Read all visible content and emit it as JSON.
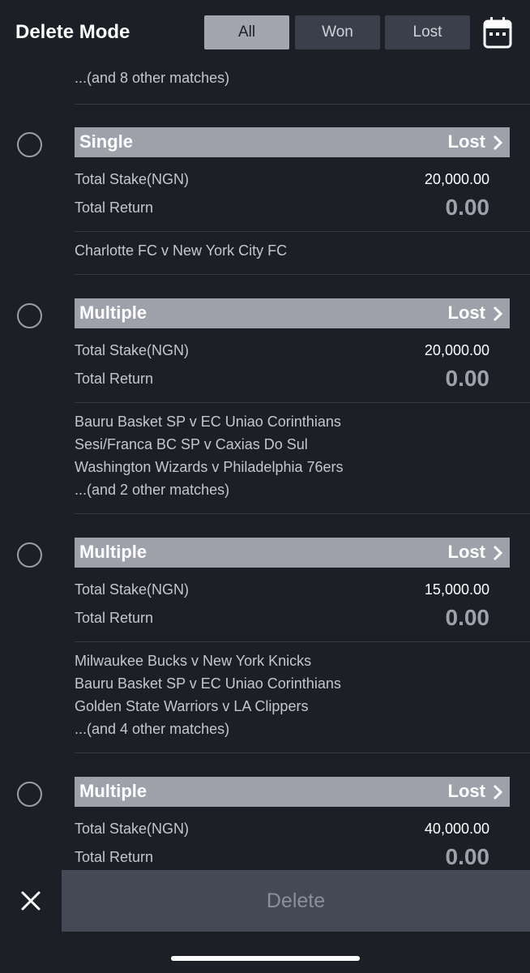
{
  "header": {
    "title": "Delete Mode",
    "filters": [
      "All",
      "Won",
      "Lost"
    ],
    "active_filter": "All",
    "calendar_icon": "calendar-icon"
  },
  "top_more": "...(and 8 other matches)",
  "bets": [
    {
      "type": "Single",
      "status": "Lost",
      "stake_label": "Total Stake(NGN)",
      "stake": "20,000.00",
      "return_label": "Total Return",
      "return": "0.00",
      "matches": [
        "Charlotte FC v New York City FC"
      ]
    },
    {
      "type": "Multiple",
      "status": "Lost",
      "stake_label": "Total Stake(NGN)",
      "stake": "20,000.00",
      "return_label": "Total Return",
      "return": "0.00",
      "matches": [
        "Bauru Basket SP v EC Uniao Corinthians",
        "Sesi/Franca BC SP v Caxias Do Sul",
        "Washington Wizards v Philadelphia 76ers",
        "...(and 2 other matches)"
      ]
    },
    {
      "type": "Multiple",
      "status": "Lost",
      "stake_label": "Total Stake(NGN)",
      "stake": "15,000.00",
      "return_label": "Total Return",
      "return": "0.00",
      "matches": [
        "Milwaukee Bucks v New York Knicks",
        "Bauru Basket SP v EC Uniao Corinthians",
        "Golden State Warriors v LA Clippers",
        "...(and 4 other matches)"
      ]
    },
    {
      "type": "Multiple",
      "status": "Lost",
      "stake_label": "Total Stake(NGN)",
      "stake": "40,000.00",
      "return_label": "Total Return",
      "return": "0.00",
      "matches": []
    }
  ],
  "bottom_bar": {
    "close_icon": "close-icon",
    "delete_label": "Delete"
  }
}
